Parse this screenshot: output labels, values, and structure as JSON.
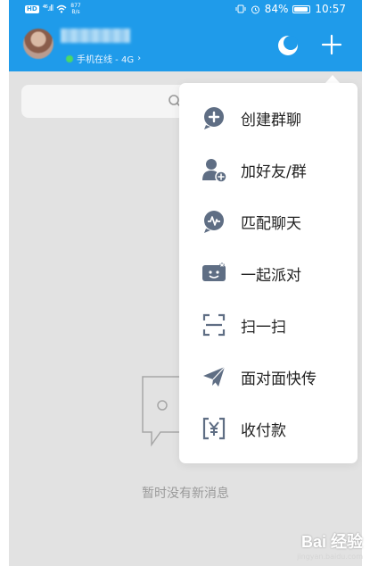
{
  "statusbar": {
    "network_badge": "HD",
    "signal": "⁴⁶.ıll",
    "speed_value": "877",
    "speed_unit": "B/s",
    "battery": "84%",
    "time": "10:57"
  },
  "header": {
    "online_status": "手机在线 - 4G",
    "online_chevron": "›"
  },
  "search": {
    "placeholder": ""
  },
  "menu": {
    "items": [
      {
        "label": "创建群聊",
        "icon": "create-group-icon"
      },
      {
        "label": "加好友/群",
        "icon": "add-friend-icon"
      },
      {
        "label": "匹配聊天",
        "icon": "match-chat-icon"
      },
      {
        "label": "一起派对",
        "icon": "party-icon"
      },
      {
        "label": "扫一扫",
        "icon": "scan-icon"
      },
      {
        "label": "面对面快传",
        "icon": "face-transfer-icon"
      },
      {
        "label": "收付款",
        "icon": "payment-icon"
      }
    ]
  },
  "empty_state": {
    "text": "暂时没有新消息"
  },
  "watermark": {
    "brand": "Bai 经验",
    "url": "jingyan.baidu.com"
  },
  "colors": {
    "header": "#1f9bea",
    "icon": "#5f6e84",
    "background": "#e2e2e2"
  }
}
